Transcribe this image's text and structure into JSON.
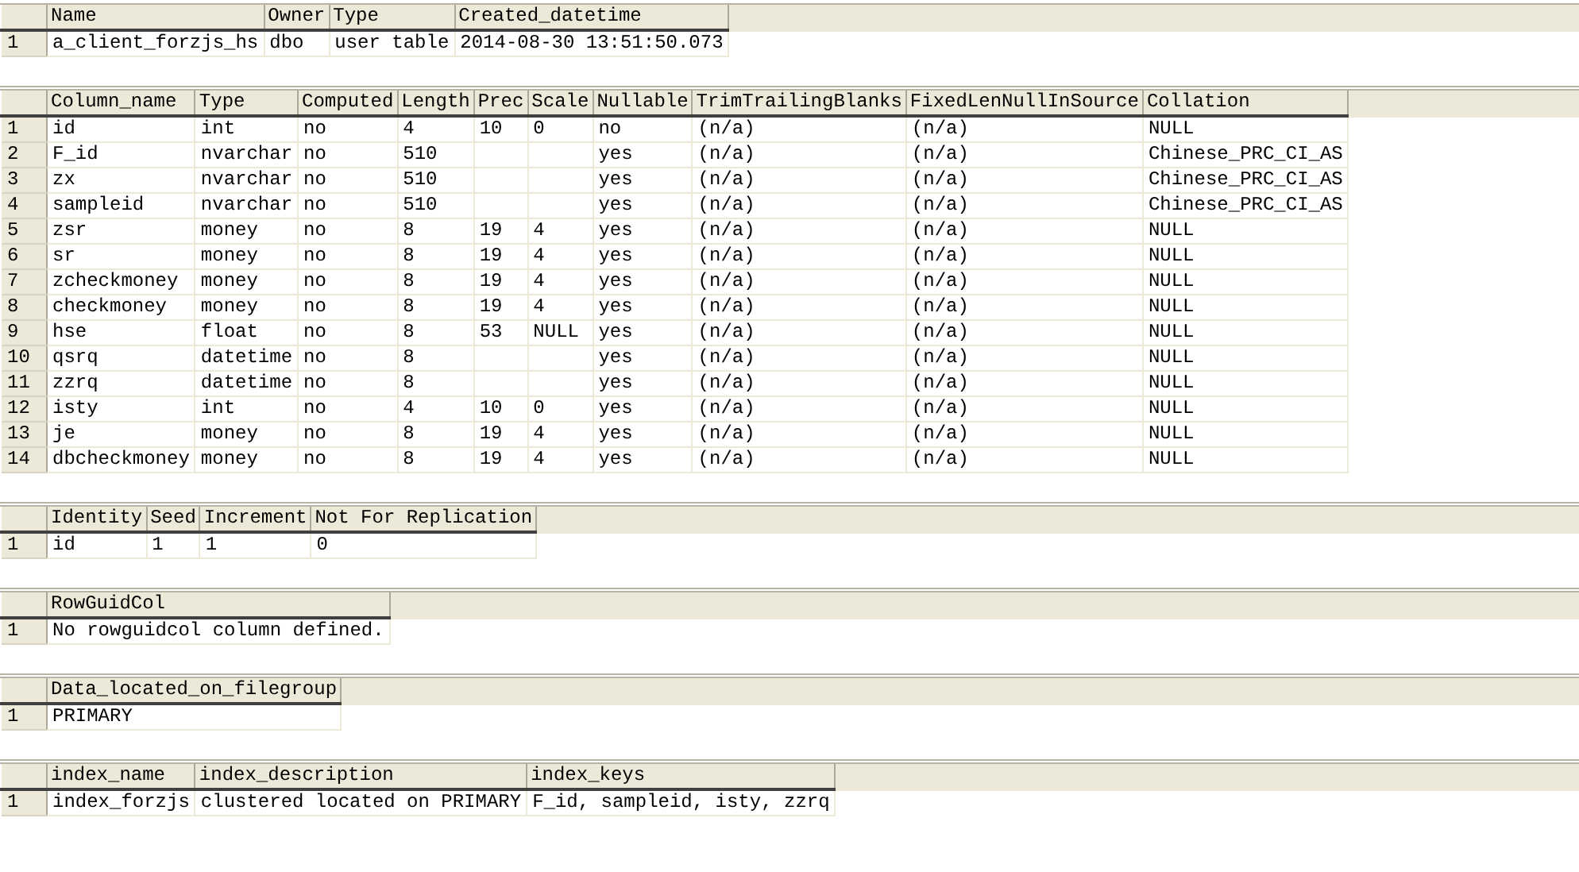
{
  "result_grids": [
    {
      "columns": [
        "Name",
        "Owner",
        "Type",
        "Created_datetime"
      ],
      "rows": [
        {
          "number": "1",
          "cells": [
            "a_client_forzjs_hs",
            "dbo",
            "user table",
            "2014-08-30 13:51:50.073"
          ]
        }
      ]
    },
    {
      "columns": [
        "Column_name",
        "Type",
        "Computed",
        "Length",
        "Prec",
        "Scale",
        "Nullable",
        "TrimTrailingBlanks",
        "FixedLenNullInSource",
        "Collation"
      ],
      "rows": [
        {
          "number": "1",
          "cells": [
            "id",
            "int",
            "no",
            "4",
            "10",
            "0",
            "no",
            "(n/a)",
            "(n/a)",
            "NULL"
          ]
        },
        {
          "number": "2",
          "cells": [
            "F_id",
            "nvarchar",
            "no",
            "510",
            null,
            null,
            "yes",
            "(n/a)",
            "(n/a)",
            "Chinese_PRC_CI_AS"
          ]
        },
        {
          "number": "3",
          "cells": [
            "zx",
            "nvarchar",
            "no",
            "510",
            null,
            null,
            "yes",
            "(n/a)",
            "(n/a)",
            "Chinese_PRC_CI_AS"
          ]
        },
        {
          "number": "4",
          "cells": [
            "sampleid",
            "nvarchar",
            "no",
            "510",
            null,
            null,
            "yes",
            "(n/a)",
            "(n/a)",
            "Chinese_PRC_CI_AS"
          ]
        },
        {
          "number": "5",
          "cells": [
            "zsr",
            "money",
            "no",
            "8",
            "19",
            "4",
            "yes",
            "(n/a)",
            "(n/a)",
            "NULL"
          ]
        },
        {
          "number": "6",
          "cells": [
            "sr",
            "money",
            "no",
            "8",
            "19",
            "4",
            "yes",
            "(n/a)",
            "(n/a)",
            "NULL"
          ]
        },
        {
          "number": "7",
          "cells": [
            "zcheckmoney",
            "money",
            "no",
            "8",
            "19",
            "4",
            "yes",
            "(n/a)",
            "(n/a)",
            "NULL"
          ]
        },
        {
          "number": "8",
          "cells": [
            "checkmoney",
            "money",
            "no",
            "8",
            "19",
            "4",
            "yes",
            "(n/a)",
            "(n/a)",
            "NULL"
          ]
        },
        {
          "number": "9",
          "cells": [
            "hse",
            "float",
            "no",
            "8",
            "53",
            "NULL",
            "yes",
            "(n/a)",
            "(n/a)",
            "NULL"
          ]
        },
        {
          "number": "10",
          "cells": [
            "qsrq",
            "datetime",
            "no",
            "8",
            null,
            null,
            "yes",
            "(n/a)",
            "(n/a)",
            "NULL"
          ]
        },
        {
          "number": "11",
          "cells": [
            "zzrq",
            "datetime",
            "no",
            "8",
            null,
            null,
            "yes",
            "(n/a)",
            "(n/a)",
            "NULL"
          ]
        },
        {
          "number": "12",
          "cells": [
            "isty",
            "int",
            "no",
            "4",
            "10",
            "0",
            "yes",
            "(n/a)",
            "(n/a)",
            "NULL"
          ]
        },
        {
          "number": "13",
          "cells": [
            "je",
            "money",
            "no",
            "8",
            "19",
            "4",
            "yes",
            "(n/a)",
            "(n/a)",
            "NULL"
          ]
        },
        {
          "number": "14",
          "cells": [
            "dbcheckmoney",
            "money",
            "no",
            "8",
            "19",
            "4",
            "yes",
            "(n/a)",
            "(n/a)",
            "NULL"
          ]
        }
      ]
    },
    {
      "columns": [
        "Identity",
        "Seed",
        "Increment",
        "Not For Replication"
      ],
      "rows": [
        {
          "number": "1",
          "cells": [
            "id",
            "1",
            "1",
            "0"
          ]
        }
      ]
    },
    {
      "columns": [
        "RowGuidCol"
      ],
      "rows": [
        {
          "number": "1",
          "cells": [
            "No rowguidcol column defined."
          ]
        }
      ]
    },
    {
      "columns": [
        "Data_located_on_filegroup"
      ],
      "rows": [
        {
          "number": "1",
          "cells": [
            "PRIMARY"
          ]
        }
      ]
    },
    {
      "columns": [
        "index_name",
        "index_description",
        "index_keys"
      ],
      "rows": [
        {
          "number": "1",
          "cells": [
            "index_forzjs",
            "clustered located on PRIMARY",
            "F_id, sampleid, isty, zzrq"
          ]
        }
      ]
    }
  ]
}
